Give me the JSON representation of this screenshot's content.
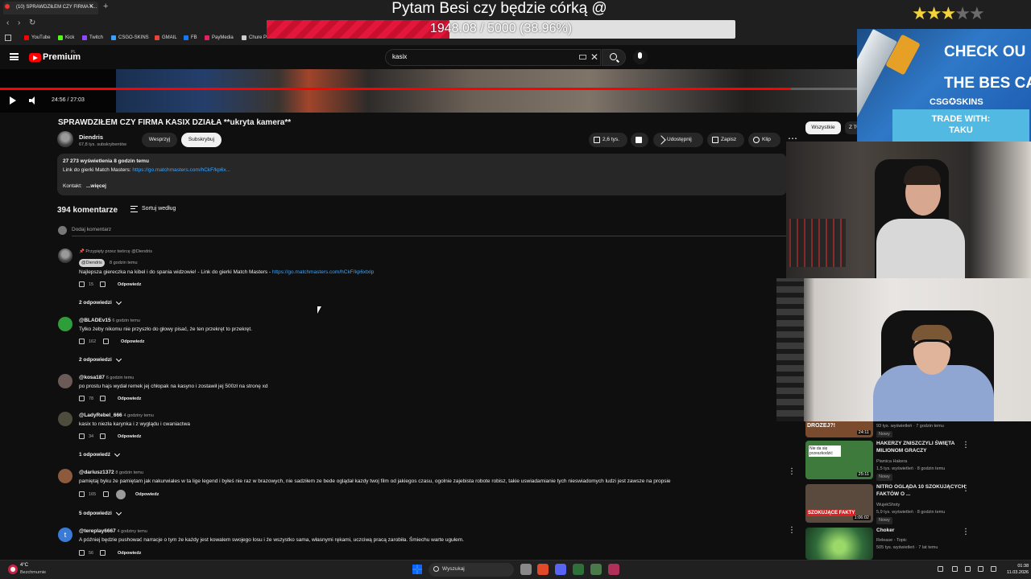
{
  "browser": {
    "tab_title": "(10) SPRAWDZIŁEM CZY FIRMA K...",
    "bookmarks": [
      {
        "label": "YouTube",
        "color": "#ff0000"
      },
      {
        "label": "Kick",
        "color": "#53fc18"
      },
      {
        "label": "Twitch",
        "color": "#9146ff"
      },
      {
        "label": "CSGO-SKINS",
        "color": "#3aa0ff"
      },
      {
        "label": "GMAIL",
        "color": "#ea4335"
      },
      {
        "label": "FB",
        "color": "#1877f2"
      },
      {
        "label": "PayMedia",
        "color": "#e91e63"
      },
      {
        "label": "Chure Porat",
        "color": "#cccccc"
      }
    ]
  },
  "stream_overlay": {
    "title": "Pytam Besi czy będzie córką @",
    "goal_text": "1948.08 / 5000 (38.96%)",
    "goal_fraction": 0.3896,
    "stars_total": 5,
    "stars_filled": 3,
    "ad": {
      "line1": "CHECK OU",
      "line2": "THE BES CASE",
      "brand": "CSG✪SKINS",
      "trade_label": "TRADE WITH:",
      "trade_name": "TAKU"
    }
  },
  "youtube": {
    "logo": "Premium",
    "logo_sup": "PL",
    "search_value": "kasix",
    "player": {
      "time": "24:56 / 27:03",
      "progress_fraction": 0.922
    },
    "video": {
      "title": "SPRAWDZIŁEM CZY FIRMA KASIX DZIAŁA **ukryta kamera**",
      "channel": "Diendris",
      "subscribers": "67,8 tys. subskrybentów",
      "support_label": "Wesprzyj",
      "subscribed_label": "Subskrybuj",
      "actions": [
        {
          "label": "2,6 tys.",
          "icon": "like-icon"
        },
        {
          "label": "",
          "icon": "dislike-icon"
        },
        {
          "label": "Udostępnij",
          "icon": "share-icon"
        },
        {
          "label": "Zapisz",
          "icon": "save-icon"
        },
        {
          "label": "Klip",
          "icon": "clip-icon"
        }
      ]
    },
    "description": {
      "stats": "27 273 wyświetlenia  8 godzin temu",
      "line_prefix": "Link do gierki Match Masters: ",
      "link": "https://go.matchmasters.com/hCkF/kp6x...",
      "contact": "Kontakt:",
      "more": "...więcej"
    },
    "comments": {
      "count": "394 komentarze",
      "sort_label": "Sortuj według",
      "add_placeholder": "Dodaj komentarz",
      "pinned_label": "Przypięty przez twórcę @Diendris",
      "creator_badge": "@Diendris",
      "creator_time": "8 godzin temu",
      "pinned_text": "Najlepsza giereczka na kibel i do spania widzowie! - Link do gierki Match Masters - ",
      "pinned_link": "https://go.matchmasters.com/hCkF/kp6xtxlp",
      "reply_label": "Odpowiedz",
      "items": [
        {
          "likes": "15",
          "replies": "2 odpowiedzi"
        },
        {
          "author": "@BLADEv15",
          "time": "6 godzin temu",
          "text": "Tylko żeby nikomu nie przyszło do głowy pisać, że ten przekręt to przekręt.",
          "likes": "162",
          "replies": "2 odpowiedzi",
          "avatar_color": "#2e9e3a"
        },
        {
          "author": "@kosa187",
          "time": "6 godzin temu",
          "text": "po prostu hajs wydał remek jej chłopak na kasyno i zostawił jej 500zł na stronę xd",
          "likes": "78",
          "replies": "",
          "avatar_color": "#6b5a55"
        },
        {
          "author": "@LadyRebel_666",
          "time": "4 godziny temu",
          "text": "kasix to niezła karynka i z wyglądu i cwaniactwa",
          "likes": "34",
          "replies": "1 odpowiedź",
          "avatar_color": "#4d4d3d"
        },
        {
          "author": "@dariusz1372",
          "time": "8 godzin temu",
          "text": "pamiętaj byku że pamiętam jak nakurwiales w ta lige legend i byłeś nie raz w brazowych, nie sadziłem ze bede oglądał kazdy twoj film od jakiegos czasu, ogolnie zajebista robote robisz, takie uswiadamianie tych nieswiadomych ludzi jest zawsze na propsie",
          "likes": "165",
          "replies": "5 odpowiedzi",
          "avatar_color": "#8c5a3c"
        },
        {
          "author": "@tereplay6667",
          "time": "4 godziny temu",
          "text": "A później będzie pushować narracje o tym że każdy jest kowalem swojego losu i że wszystko sama, własnymi rękami, uczciwą pracą zarobiła. Śmiechu warte ugułem.",
          "likes": "56",
          "replies": "",
          "avatar_color": "#3a7bd5",
          "initial": "t"
        }
      ]
    },
    "sidebar": {
      "chip_all": "Wszystkie",
      "chip_yours": "Z Twoich wyników",
      "recommendations": [
        {
          "title": "",
          "channel": "93 tys. wyświetleń · 7 godzin temu",
          "meta": "",
          "badge": "Nowy",
          "duration": "24:11",
          "thumb_text": "DROZEJ?!",
          "thumb_color": "#7a4b2c"
        },
        {
          "title": "HAKERZY ZNISZCZYLI ŚWIĘTA MILIONOM GRACZY",
          "channel": "Piwnica Hakera",
          "meta": "1,5 tys. wyświetleń · 8 godzin temu",
          "badge": "Nowy",
          "duration": "25:11",
          "thumb_text": "Nie da się przeszkodzić",
          "thumb_color": "#3f7a3d"
        },
        {
          "title": "NITRO OGLĄDA 10 SZOKUJĄCYCH FAKTÓW O ...",
          "channel": "WujekShoty",
          "meta": "5,9 tys. wyświetleń · 8 godzin temu",
          "badge": "Nowy",
          "duration": "1:06:02",
          "thumb_text": "SZOKUJĄCE FAKTY",
          "thumb_color": "#5a4a3e"
        },
        {
          "title": "Choker",
          "channel": "Release - Topic",
          "meta": "505 tys. wyświetleń · 7 lat temu",
          "badge": "",
          "duration": "",
          "thumb_text": "",
          "thumb_color": "#2f6a3a"
        }
      ]
    }
  },
  "taskbar": {
    "weather_temp": "4°C",
    "weather_desc": "Bezchmurnie",
    "search_label": "Wyszukaj",
    "time": "01:38",
    "date": "11.03.2026"
  }
}
